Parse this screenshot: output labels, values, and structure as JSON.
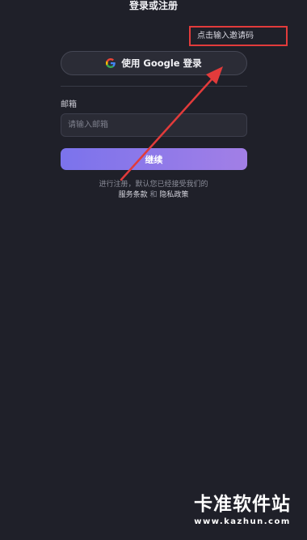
{
  "header": {
    "title": "登录或注册"
  },
  "invite": {
    "label": "点击输入邀请码"
  },
  "google": {
    "label": "使用 Google 登录",
    "icon": "google-icon"
  },
  "email": {
    "label": "邮箱",
    "placeholder": "请输入邮箱",
    "value": ""
  },
  "continue": {
    "label": "继续",
    "gradient": [
      "#7b73ec",
      "#a27fe6"
    ]
  },
  "terms": {
    "line1": "进行注册，默认您已经接受我们的",
    "tos": "服务条款",
    "and": "和",
    "privacy": "隐私政策"
  },
  "annotation": {
    "color": "#e23b3b"
  },
  "watermark": {
    "brand": "卡准软件站",
    "url": "www.kazhun.com"
  }
}
